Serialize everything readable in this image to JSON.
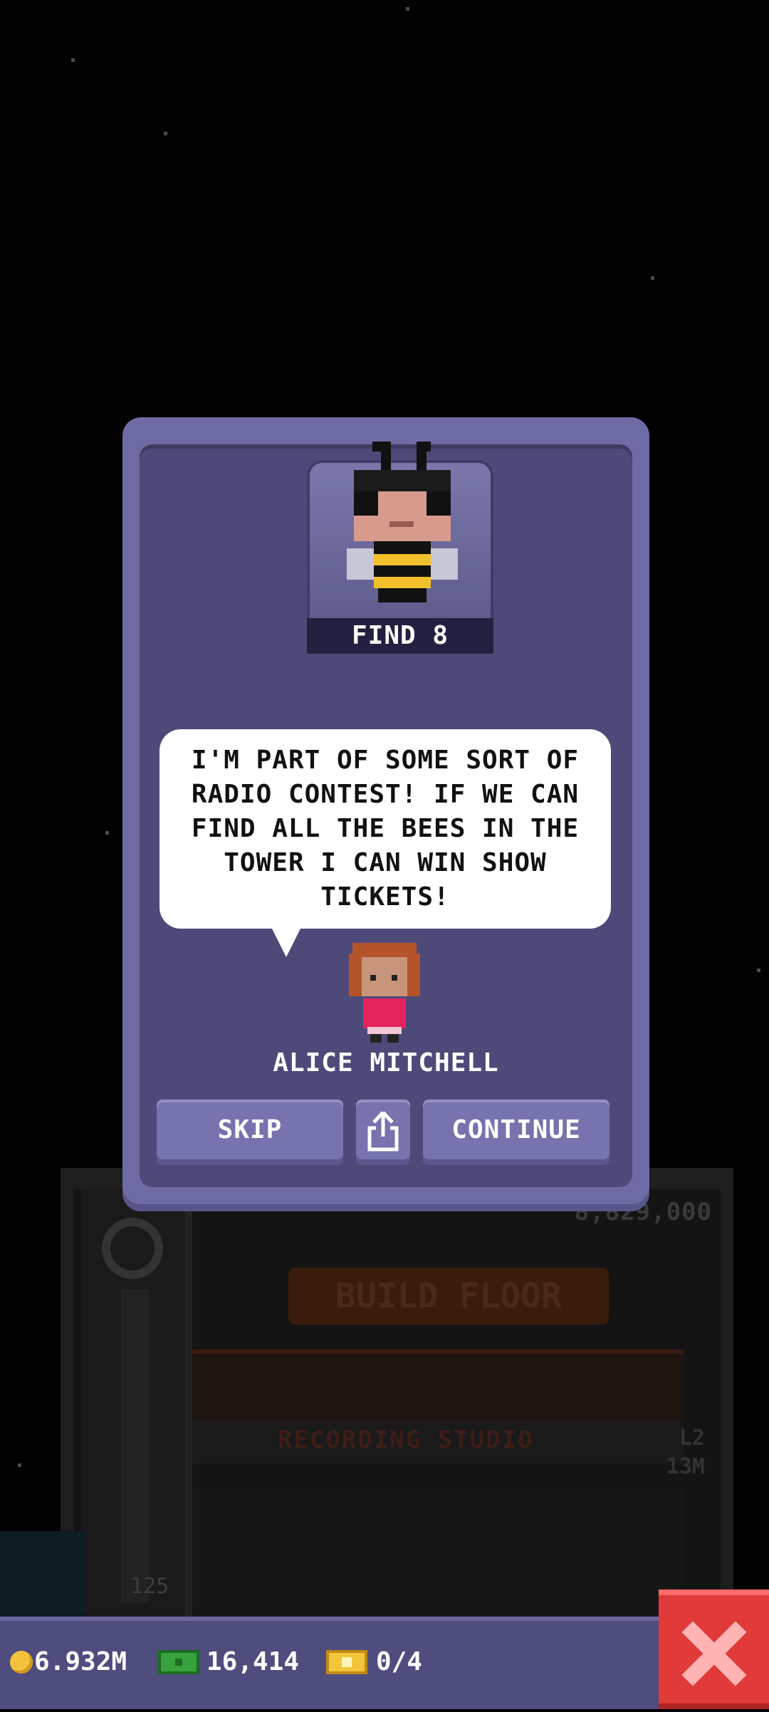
{
  "modal": {
    "find_label": "FIND 8",
    "speech": "I'M PART OF SOME SORT OF RADIO CONTEST! IF WE CAN FIND ALL THE BEES IN THE TOWER I CAN WIN SHOW TICKETS!",
    "speaker_name": "ALICE MITCHELL",
    "buttons": {
      "skip": "SKIP",
      "share_icon": "share-icon",
      "continue": "CONTINUE"
    }
  },
  "tower": {
    "build_cost": "8,829,000",
    "build_label": "BUILD FLOOR",
    "floor_name": "RECORDING STUDIO",
    "floor_level": "L2",
    "floor_income": "13M",
    "elevator_count": "125"
  },
  "statusbar": {
    "coins": "6.932M",
    "tower_bux": "16,414",
    "tickets": "0/4",
    "close_icon": "close-icon"
  },
  "colors": {
    "modal_bg": "#4d4a79",
    "modal_frame": "#6e6ba4",
    "button": "#7673ae",
    "close_button": "#e03a3a",
    "statusbar": "#4f4c7e"
  }
}
